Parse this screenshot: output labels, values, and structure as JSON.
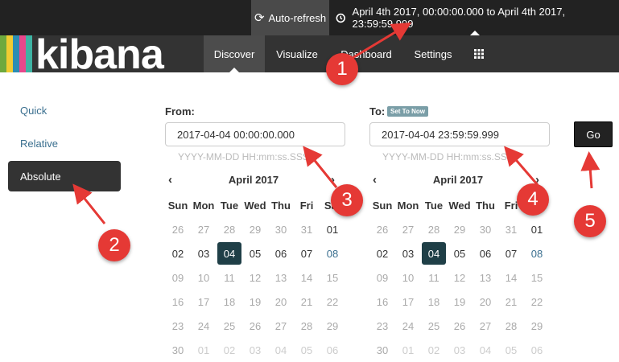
{
  "topbar": {
    "autorefresh_label": "Auto-refresh",
    "time_range": "April 4th 2017, 00:00:00.000 to April 4th 2017, 23:59:59.999"
  },
  "logo": {
    "text": "kibana",
    "stripe_colors": [
      "#e8478b",
      "#f0cc32",
      "#3eb3a3",
      "#6ea93e",
      "#2b8db3"
    ]
  },
  "nav": {
    "items": [
      {
        "label": "Discover"
      },
      {
        "label": "Visualize"
      },
      {
        "label": "Dashboard"
      },
      {
        "label": "Settings"
      }
    ],
    "grid_icon": "apps-grid-icon"
  },
  "sidebar": {
    "items": [
      {
        "label": "Quick"
      },
      {
        "label": "Relative"
      },
      {
        "label": "Absolute"
      }
    ]
  },
  "from": {
    "label": "From:",
    "value": "2017-04-04 00:00:00.000",
    "format_hint": "YYYY-MM-DD HH:mm:ss.SSS"
  },
  "to": {
    "label": "To:",
    "set_now": "Set To Now",
    "value": "2017-04-04 23:59:59.999",
    "format_hint": "YYYY-MM-DD HH:mm:ss.SSS"
  },
  "go_label": "Go",
  "calendar": {
    "month": "April 2017",
    "prev": "‹",
    "next": "›",
    "weekdays": [
      "Sun",
      "Mon",
      "Tue",
      "Wed",
      "Thu",
      "Fri",
      "Sat"
    ],
    "weeks": [
      [
        "26",
        "27",
        "28",
        "29",
        "30",
        "31",
        "01"
      ],
      [
        "02",
        "03",
        "04",
        "05",
        "06",
        "07",
        "08"
      ],
      [
        "09",
        "10",
        "11",
        "12",
        "13",
        "14",
        "15"
      ],
      [
        "16",
        "17",
        "18",
        "19",
        "20",
        "21",
        "22"
      ],
      [
        "23",
        "24",
        "25",
        "26",
        "27",
        "28",
        "29"
      ],
      [
        "30",
        "01",
        "02",
        "03",
        "04",
        "05",
        "06"
      ]
    ],
    "selected": "04"
  },
  "markers": [
    "1",
    "2",
    "3",
    "4",
    "5"
  ],
  "colors": {
    "marker": "#e53935",
    "selected_day": "#1f3f47",
    "link": "#3a6f8f"
  }
}
